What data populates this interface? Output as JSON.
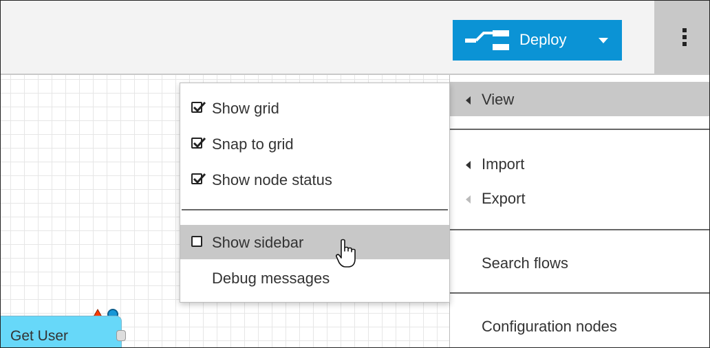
{
  "header": {
    "deploy": {
      "label": "Deploy",
      "icon": "deploy-icon",
      "color": "#0b93d5"
    },
    "menu_button": {
      "icon": "vertical-ellipsis-icon"
    }
  },
  "canvas": {
    "node": {
      "label": "Get User",
      "color": "#67d8f9"
    }
  },
  "main_menu": {
    "items": [
      {
        "label": "View",
        "has_submenu": true,
        "active": true
      },
      {
        "label": "Import",
        "has_submenu": true
      },
      {
        "label": "Export",
        "has_submenu": true,
        "disabled": true
      },
      {
        "label": "Search flows"
      },
      {
        "label": "Configuration nodes"
      }
    ]
  },
  "view_submenu": {
    "items": [
      {
        "label": "Show grid",
        "checked": true
      },
      {
        "label": "Snap to grid",
        "checked": true
      },
      {
        "label": "Show node status",
        "checked": true
      },
      {
        "label": "Show sidebar",
        "checked": false
      },
      {
        "label": "Debug messages"
      }
    ]
  }
}
